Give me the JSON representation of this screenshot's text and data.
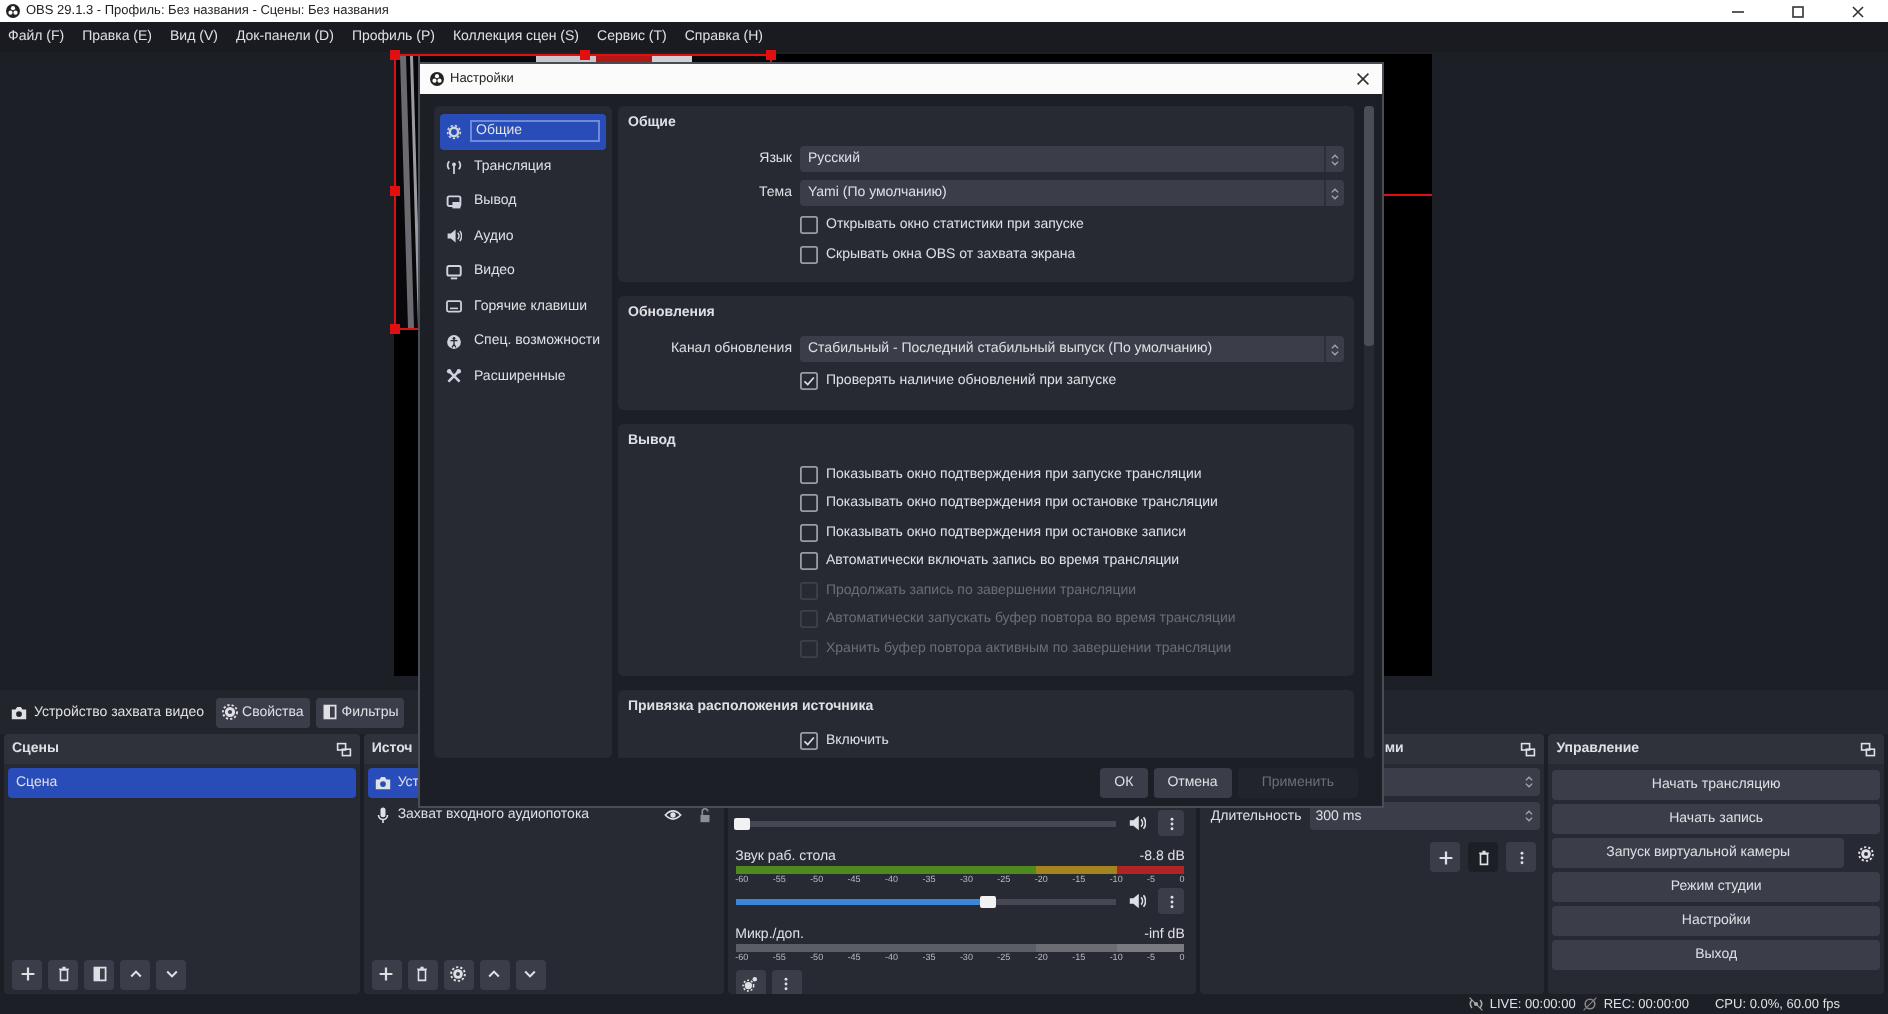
{
  "window": {
    "title": "OBS 29.1.3 - Профиль: Без названия - Сцены: Без названия"
  },
  "menu": [
    "Файл (F)",
    "Правка (E)",
    "Вид (V)",
    "Док-панели (D)",
    "Профиль (P)",
    "Коллекция сцен (S)",
    "Сервис (T)",
    "Справка (H)"
  ],
  "source_toolbar": {
    "source": "Устройство захвата видео",
    "buttons": [
      "Свойства",
      "Фильтры"
    ]
  },
  "scenes": {
    "title": "Сцены",
    "items": [
      {
        "label": "Сцена",
        "selected": true
      }
    ]
  },
  "sources": {
    "title": "Источ",
    "items": [
      {
        "label": "Уст",
        "selected": true
      },
      {
        "label": "Захват входного аудиопотока",
        "selected": false
      }
    ]
  },
  "mixer": {
    "channels": [
      {
        "level": 0.02
      },
      {
        "name": "Звук раб. стола",
        "reading": "-8.8 dB",
        "active": true,
        "scale": [
          "-60",
          "-55",
          "-50",
          "-45",
          "-40",
          "-35",
          "-30",
          "-25",
          "-20",
          "-15",
          "-10",
          "-5",
          "0"
        ],
        "level": 0.66
      },
      {
        "name": "Микр./доп.",
        "reading": "-inf dB",
        "active": false,
        "scale": [
          "-60",
          "-55",
          "-50",
          "-45",
          "-40",
          "-35",
          "-30",
          "-25",
          "-20",
          "-15",
          "-10",
          "-5",
          "0"
        ]
      }
    ]
  },
  "transitions": {
    "title": "ми",
    "duration_label": "Длительность",
    "duration_value": "300 ms"
  },
  "controls": {
    "title": "Управление",
    "buttons": [
      "Начать трансляцию",
      "Начать запись",
      "Запуск виртуальной камеры",
      "Режим студии",
      "Настройки",
      "Выход"
    ]
  },
  "status_bar": {
    "live": "LIVE: 00:00:00",
    "rec": "REC: 00:00:00",
    "cpu": "CPU: 0.0%, 60.00 fps"
  },
  "settings_dialog": {
    "title": "Настройки",
    "sidebar": [
      {
        "label": "Общие",
        "selected": true
      },
      {
        "label": "Трансляция",
        "selected": false
      },
      {
        "label": "Вывод",
        "selected": false
      },
      {
        "label": "Аудио",
        "selected": false
      },
      {
        "label": "Видео",
        "selected": false
      },
      {
        "label": "Горячие клавиши",
        "selected": false
      },
      {
        "label": "Спец. возможности",
        "selected": false
      },
      {
        "label": "Расширенные",
        "selected": false
      }
    ],
    "groups": [
      {
        "title": "Общие",
        "rows": [
          {
            "kind": "select",
            "label": "Язык",
            "value": "Русский"
          },
          {
            "kind": "select",
            "label": "Тема",
            "value": "Yami (По умолчанию)"
          },
          {
            "kind": "checkbox",
            "label": "Открывать окно статистики при запуске",
            "checked": false,
            "disabled": false
          },
          {
            "kind": "checkbox",
            "label": "Скрывать окна OBS от захвата экрана",
            "checked": false,
            "disabled": false
          }
        ]
      },
      {
        "title": "Обновления",
        "rows": [
          {
            "kind": "select",
            "label": "Канал обновления",
            "value": "Стабильный - Последний стабильный выпуск (По умолчанию)"
          },
          {
            "kind": "checkbox",
            "label": "Проверять наличие обновлений при запуске",
            "checked": true,
            "disabled": false
          }
        ]
      },
      {
        "title": "Вывод",
        "rows": [
          {
            "kind": "checkbox",
            "label": "Показывать окно подтверждения при запуске трансляции",
            "checked": false,
            "disabled": false
          },
          {
            "kind": "checkbox",
            "label": "Показывать окно подтверждения при остановке трансляции",
            "checked": false,
            "disabled": false
          },
          {
            "kind": "checkbox",
            "label": "Показывать окно подтверждения при остановке записи",
            "checked": false,
            "disabled": false
          },
          {
            "kind": "checkbox",
            "label": "Автоматически включать запись во время трансляции",
            "checked": false,
            "disabled": false
          },
          {
            "kind": "checkbox",
            "label": "Продолжать запись по завершении трансляции",
            "checked": false,
            "disabled": true
          },
          {
            "kind": "checkbox",
            "label": "Автоматически запускать буфер повтора во время трансляции",
            "checked": false,
            "disabled": true
          },
          {
            "kind": "checkbox",
            "label": "Хранить буфер повтора активным по завершении трансляции",
            "checked": false,
            "disabled": true
          }
        ]
      },
      {
        "title": "Привязка расположения источника",
        "rows": [
          {
            "kind": "checkbox",
            "label": "Включить",
            "checked": true,
            "disabled": false
          }
        ]
      }
    ],
    "buttons": [
      {
        "label": "ОК",
        "disabled": false
      },
      {
        "label": "Отмена",
        "disabled": false
      },
      {
        "label": "Применить",
        "disabled": true
      }
    ]
  }
}
